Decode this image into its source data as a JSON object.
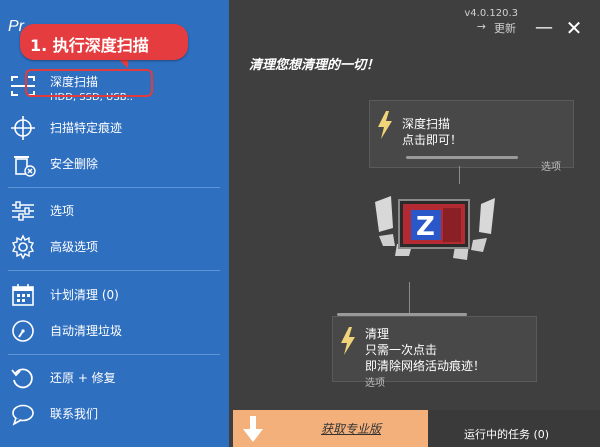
{
  "app": {
    "title_partial": "Pr",
    "version": "v4.0.120.3",
    "update_label": "更新"
  },
  "annotation": {
    "text": "1. 执行深度扫描",
    "color": "#e53d3f"
  },
  "sidebar": {
    "items": [
      {
        "icon": "deep-scan-icon",
        "label": "深度扫描",
        "sub": "HDD, SSD, USB.."
      },
      {
        "icon": "crosshair-icon",
        "label": "扫描特定痕迹"
      },
      {
        "icon": "trash-icon",
        "label": "安全删除"
      },
      {
        "icon": "sliders-icon",
        "label": "选项"
      },
      {
        "icon": "gear-icon",
        "label": "高级选项"
      },
      {
        "icon": "calendar-icon",
        "label": "计划清理 (0)"
      },
      {
        "icon": "gauge-icon",
        "label": "自动清理垃圾"
      },
      {
        "icon": "restore-icon",
        "label": "还原 + 修复"
      },
      {
        "icon": "chat-icon",
        "label": "联系我们"
      }
    ]
  },
  "main": {
    "headline": "清理您想清理的一切！",
    "deep_scan_card": {
      "title": "深度扫描",
      "desc": "点击即可！",
      "options": "选项"
    },
    "clean_card": {
      "title": "清理",
      "desc": "只需一次点击",
      "desc2": "即清除网络活动痕迹！",
      "options": "选项"
    },
    "pro_banner": "获取专业版",
    "tasks": "运行中的任务 (0)"
  },
  "colors": {
    "sidebar_bg": "#2f6fc0",
    "main_bg": "#3f3f3f",
    "banner_bg": "#f4b07b",
    "bolt": "#f1d47a"
  }
}
